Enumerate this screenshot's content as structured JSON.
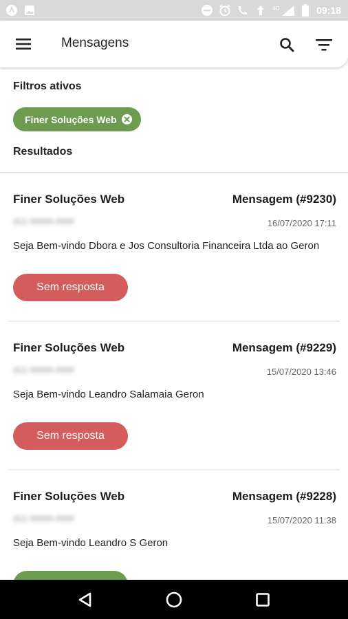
{
  "status_bar": {
    "time": "09:18",
    "icons_left": [
      "app-notification-icon",
      "image-notification-icon"
    ],
    "icons_right": [
      "do-not-disturb-icon",
      "alarm-icon",
      "wifi-call-icon",
      "data-icon",
      "signal-4g-icon",
      "battery-icon"
    ],
    "network_label": "4G"
  },
  "app_bar": {
    "title": "Mensagens",
    "menu_icon": "menu-icon",
    "search_icon": "search-icon",
    "filter_icon": "filter-icon"
  },
  "filters": {
    "heading": "Filtros ativos",
    "chips": [
      {
        "label": "Finer Soluções Web",
        "color": "#6d9b4f"
      }
    ]
  },
  "results": {
    "heading": "Resultados"
  },
  "messages": [
    {
      "sender": "Finer Soluções Web",
      "id_label": "Mensagem (#9230)",
      "phone": "(62) 99999-9999",
      "date": "16/07/2020  17:11",
      "text": "Seja Bem-vindo Dbora e Jos Consultoria Financeira Ltda ao Geron",
      "status": "Sem resposta",
      "status_color": "#d45c5c"
    },
    {
      "sender": "Finer Soluções Web",
      "id_label": "Mensagem (#9229)",
      "phone": "(62) 99999-9999",
      "date": "15/07/2020  13:46",
      "text": "Seja Bem-vindo Leandro Salamaia  Geron",
      "status": "Sem resposta",
      "status_color": "#d45c5c"
    },
    {
      "sender": "Finer Soluções Web",
      "id_label": "Mensagem (#9228)",
      "phone": "(62) 99999-9999",
      "date": "15/07/2020  11:38",
      "text": "Seja Bem-vindo Leandro S  Geron",
      "status": "",
      "status_color": "#6d9b4f"
    }
  ],
  "nav_bar": {
    "back_icon": "back-triangle-icon",
    "home_icon": "home-circle-icon",
    "recents_icon": "recents-square-icon"
  }
}
